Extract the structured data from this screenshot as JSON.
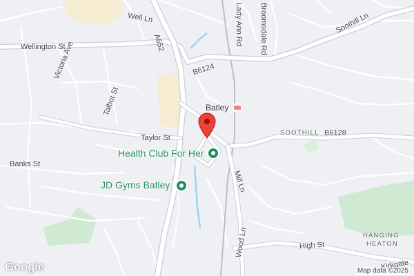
{
  "map": {
    "streets": {
      "well_ln": "Well Ln",
      "wellington_st": "Wellington St",
      "victoria_ave": "Victoria Ave",
      "talbot_st": "Talbot St",
      "a652": "A652",
      "lady_ann_rd": "Lady Ann Rd",
      "broomsdale_rd": "Broomsdale Rd",
      "soothill_ln": "Soothill Ln",
      "b6124": "B6124",
      "taylor_st": "Taylor St",
      "banks_st": "Banks St",
      "b6128": "B6128",
      "mill_ln": "Mill Ln",
      "wood_ln": "Wood Ln",
      "high_st": "High St",
      "kirkgate": "Kirkgate"
    },
    "places": {
      "batley": "Batley",
      "soothill": "SOOTHILL",
      "hanging_heaton_1": "HANGING",
      "hanging_heaton_2": "HEATON"
    },
    "pois": [
      {
        "name": "Health Club For Her",
        "icon": "fitness-pin-icon"
      },
      {
        "name": "JD Gyms Batley",
        "icon": "fitness-pin-icon"
      }
    ],
    "marker_icon": "red-location-pin-icon",
    "station_icon": "rail-station-icon",
    "logo": "Google",
    "attribution": "Map data ©2025",
    "colors": {
      "background": "#eef0f3",
      "road": "#ffffff",
      "road_outline": "#c9ced6",
      "park": "#cfe9d2",
      "water": "#9fd3f0",
      "sand": "#f3e6c5",
      "poi_green": "#1e8f5a",
      "pin_red": "#ea4335"
    }
  }
}
